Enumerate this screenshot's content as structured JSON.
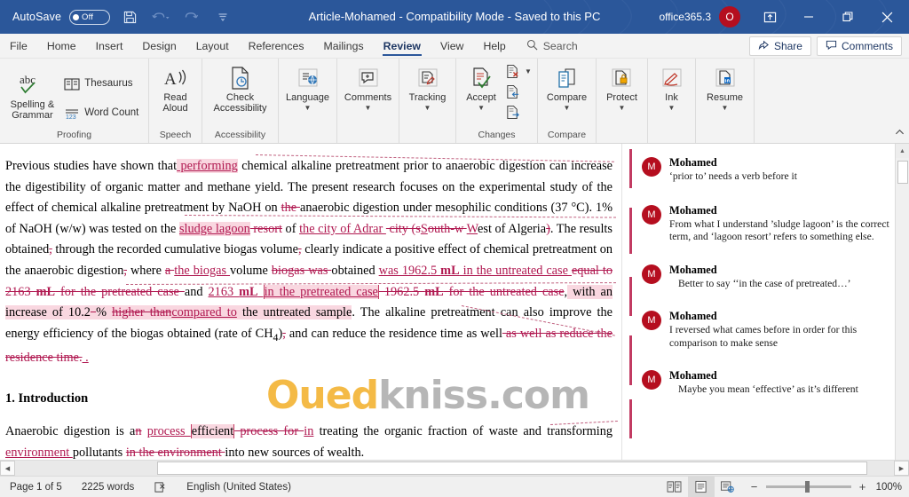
{
  "titlebar": {
    "autosave_label": "AutoSave",
    "autosave_state": "Off",
    "save_icon": "save-icon",
    "undo_icon": "undo-icon",
    "redo_icon": "redo-icon",
    "customize_icon": "customize-quick-access-icon",
    "document_title": "Article-Mohamed  -  Compatibility Mode  -  Saved to this PC",
    "account_name": "office365.3",
    "account_initial": "O",
    "ribbon_display_icon": "ribbon-display-options-icon",
    "minimize_icon": "minimize-icon",
    "restore_icon": "restore-icon",
    "close_icon": "close-icon"
  },
  "tabs": [
    {
      "label": "File",
      "active": false
    },
    {
      "label": "Home",
      "active": false
    },
    {
      "label": "Insert",
      "active": false
    },
    {
      "label": "Design",
      "active": false
    },
    {
      "label": "Layout",
      "active": false
    },
    {
      "label": "References",
      "active": false
    },
    {
      "label": "Mailings",
      "active": false
    },
    {
      "label": "Review",
      "active": true
    },
    {
      "label": "View",
      "active": false
    },
    {
      "label": "Help",
      "active": false
    }
  ],
  "search": {
    "placeholder": "Search",
    "icon": "search-icon"
  },
  "tabbar_right": {
    "share_label": "Share",
    "share_icon": "share-icon",
    "comments_label": "Comments",
    "comments_icon": "comment-icon"
  },
  "ribbon": {
    "collapse_icon": "collapse-ribbon-icon",
    "groups": [
      {
        "title": "Proofing",
        "items": [
          {
            "label": "Spelling &\nGrammar",
            "icon": "spelling-grammar-icon",
            "layout": "large"
          },
          {
            "label": "Thesaurus",
            "icon": "thesaurus-icon",
            "layout": "small"
          },
          {
            "label": "Word Count",
            "icon": "word-count-icon",
            "layout": "small"
          }
        ]
      },
      {
        "title": "Speech",
        "items": [
          {
            "label": "Read\nAloud",
            "icon": "read-aloud-icon",
            "layout": "large"
          }
        ]
      },
      {
        "title": "Accessibility",
        "items": [
          {
            "label": "Check\nAccessibility",
            "icon": "check-accessibility-icon",
            "layout": "large"
          }
        ]
      },
      {
        "title": "",
        "items": [
          {
            "label": "Language",
            "icon": "language-icon",
            "layout": "large",
            "dropdown": true
          }
        ]
      },
      {
        "title": "",
        "items": [
          {
            "label": "Comments",
            "icon": "comments-icon",
            "layout": "large",
            "dropdown": true
          }
        ]
      },
      {
        "title": "",
        "items": [
          {
            "label": "Tracking",
            "icon": "tracking-icon",
            "layout": "large",
            "dropdown": true
          }
        ]
      },
      {
        "title": "Changes",
        "items": [
          {
            "label": "Accept",
            "icon": "accept-change-icon",
            "layout": "large",
            "dropdown": true
          },
          {
            "label": "",
            "icon": "reject-change-icon",
            "layout": "mini"
          },
          {
            "label": "",
            "icon": "previous-change-icon",
            "layout": "mini"
          },
          {
            "label": "",
            "icon": "next-change-icon",
            "layout": "mini"
          }
        ]
      },
      {
        "title": "Compare",
        "items": [
          {
            "label": "Compare",
            "icon": "compare-icon",
            "layout": "large",
            "dropdown": true
          }
        ]
      },
      {
        "title": "",
        "items": [
          {
            "label": "Protect",
            "icon": "protect-icon",
            "layout": "large",
            "dropdown": true
          }
        ]
      },
      {
        "title": "",
        "items": [
          {
            "label": "Ink",
            "icon": "ink-icon",
            "layout": "large",
            "dropdown": true
          }
        ]
      },
      {
        "title": "",
        "items": [
          {
            "label": "Resume",
            "icon": "resume-assistant-icon",
            "layout": "large",
            "dropdown": true
          }
        ]
      }
    ]
  },
  "document": {
    "heading": "1. Introduction",
    "paragraph1_runs": [
      {
        "text": "Previous studies have shown that",
        "type": "normal"
      },
      {
        "text": " performing",
        "type": "ins-hl"
      },
      {
        "text": " chemical alkaline pretreatment prior to anaerobic digestion can increase the digestibility of organic matter and methane yield. The present research focuses on the experimental study of the effect of chemical alkaline pretreatment by NaOH on ",
        "type": "normal"
      },
      {
        "text": "the ",
        "type": "del"
      },
      {
        "text": "anaerobic digestion under mesophilic conditions (37 °C). 1% of NaOH (w/w) was tested on the ",
        "type": "normal"
      },
      {
        "text": "sludge lagoon",
        "type": "ins-hl"
      },
      {
        "text": " resort",
        "type": "del"
      },
      {
        "text": " of ",
        "type": "normal"
      },
      {
        "text": "the city of Adrar ",
        "type": "ins"
      },
      {
        "text": " city (s",
        "type": "del"
      },
      {
        "text": "S",
        "type": "ins"
      },
      {
        "text": "outh-w ",
        "type": "del"
      },
      {
        "text": "W",
        "type": "ins"
      },
      {
        "text": "est of Algeria",
        "type": "normal"
      },
      {
        "text": ")",
        "type": "del"
      },
      {
        "text": ". The results obtained",
        "type": "normal"
      },
      {
        "text": ",",
        "type": "del"
      },
      {
        "text": " through the recorded cumulative biogas volume",
        "type": "normal"
      },
      {
        "text": ",",
        "type": "del"
      },
      {
        "text": " clearly indicate a positive effect of chemical pretreatment on the anaerobic digestion",
        "type": "normal"
      },
      {
        "text": ",",
        "type": "del"
      },
      {
        "text": " where ",
        "type": "normal"
      },
      {
        "text": "a ",
        "type": "del"
      },
      {
        "text": "the biogas ",
        "type": "ins"
      },
      {
        "text": "volume ",
        "type": "normal"
      },
      {
        "text": "biogas was ",
        "type": "del"
      },
      {
        "text": "obtained ",
        "type": "normal"
      },
      {
        "text": "was 1962.5 mL in the untreated case ",
        "type": "ins"
      },
      {
        "text": "equal to 2163 mL for the pretreated case ",
        "type": "del"
      },
      {
        "text": "and ",
        "type": "normal"
      },
      {
        "text": "2163 mL ",
        "type": "ins"
      },
      {
        "text": "in the pretreated case",
        "type": "ins-hl"
      },
      {
        "text": " 1962.5 mL for the untreated case",
        "type": "del"
      },
      {
        "text": ",",
        "type": "normal"
      },
      {
        "text": " with an increase of 10.2",
        "type": "hl"
      },
      {
        "text": " ",
        "type": "del"
      },
      {
        "text": "% ",
        "type": "hl"
      },
      {
        "text": "higher than",
        "type": "del"
      },
      {
        "text": "compared to",
        "type": "ins-hl"
      },
      {
        "text": " the untreated sample",
        "type": "hl"
      },
      {
        "text": ". The alkaline pretreatment can also improve the energy efficiency of the biogas obtained (rate of CH",
        "type": "normal"
      },
      {
        "text": "4",
        "type": "sub"
      },
      {
        "text": ")",
        "type": "normal"
      },
      {
        "text": ",",
        "type": "del"
      },
      {
        "text": " and can reduce the residence time as well",
        "type": "normal"
      },
      {
        "text": " as well as reduce the residence time.",
        "type": "del"
      },
      {
        "text": ".",
        "type": "ins"
      }
    ],
    "paragraph2_runs": [
      {
        "text": "Anaerobic digestion is a",
        "type": "normal"
      },
      {
        "text": "n",
        "type": "del"
      },
      {
        "text": " process ",
        "type": "ins"
      },
      {
        "text": "efficient",
        "type": "hl"
      },
      {
        "text": " process for ",
        "type": "del"
      },
      {
        "text": "in",
        "type": "ins"
      },
      {
        "text": " treating the organic fraction of waste and transforming ",
        "type": "normal"
      },
      {
        "text": "environment ",
        "type": "ins"
      },
      {
        "text": "pollutants ",
        "type": "normal"
      },
      {
        "text": "in the environment ",
        "type": "del"
      },
      {
        "text": "into new sources of wealth.",
        "type": "normal"
      }
    ]
  },
  "watermark": {
    "part1": "Oued",
    "part2": "kniss.com"
  },
  "comments": [
    {
      "author": "Mohamed",
      "initial": "M",
      "text": "‘prior to’ needs a verb before it"
    },
    {
      "author": "Mohamed",
      "initial": "M",
      "text": "From what I understand ’sludge lagoon’ is the correct term, and ‘lagoon resort’ refers to something else."
    },
    {
      "author": "Mohamed",
      "initial": "M",
      "text": "Better to say ‘‘in the case of pretreated…’"
    },
    {
      "author": "Mohamed",
      "initial": "M",
      "text": "I reversed what cames before in order for this comparison to make sense"
    },
    {
      "author": "Mohamed",
      "initial": "M",
      "text": "Maybe you mean ‘effective’ as it’s different"
    }
  ],
  "statusbar": {
    "page_info": "Page 1 of 5",
    "word_count": "2225 words",
    "proofing_icon": "proofing-errors-icon",
    "language": "English (United States)",
    "view_read_icon": "read-mode-icon",
    "view_print_icon": "print-layout-icon",
    "view_web_icon": "web-layout-icon",
    "zoom_out_label": "−",
    "zoom_in_label": "+",
    "zoom_level": "100%"
  },
  "colors": {
    "titlebar_blue": "#2b579a",
    "accent_red": "#b50e1f",
    "revision_pink": "#b01850",
    "highlight_pink": "#f9d7e0"
  }
}
